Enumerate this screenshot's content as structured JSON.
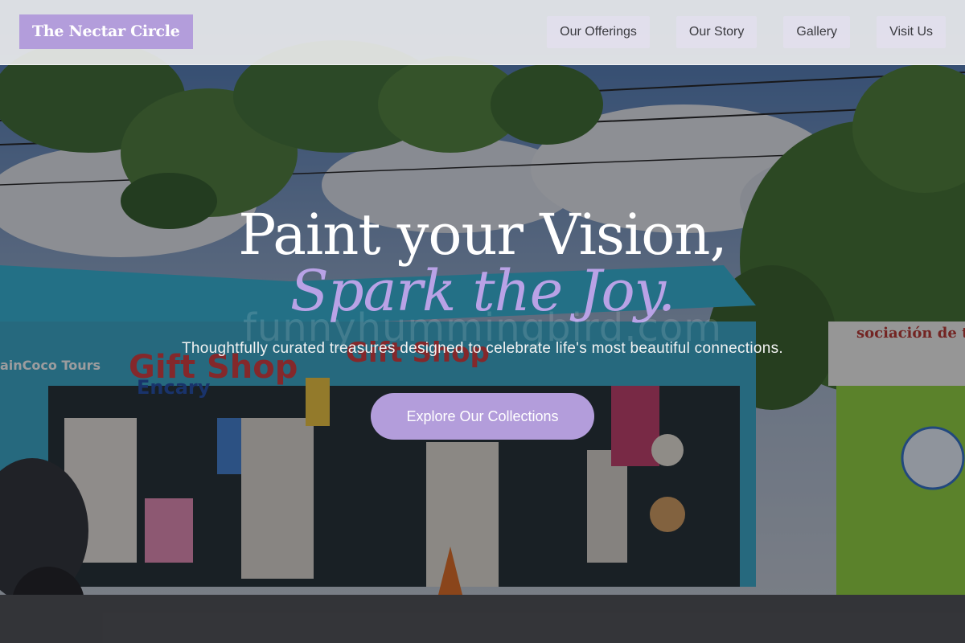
{
  "navbar": {
    "brand": "The Nectar Circle",
    "links": [
      {
        "label": "Our Offerings"
      },
      {
        "label": "Our Story"
      },
      {
        "label": "Gallery"
      },
      {
        "label": "Visit Us"
      }
    ]
  },
  "hero": {
    "headline_line1": "Paint your Vision,",
    "headline_line2": "Spark the Joy.",
    "watermark": "funnyhummingbird.com",
    "subtitle": "Thoughtfully curated treasures designed to celebrate life's most beautiful connections.",
    "cta_label": "Explore Our Collections",
    "background_signs": {
      "gift_shop_left": "Gift Shop",
      "encary": "Encary",
      "gift_shop_center": "Gift Shop",
      "coco_tours": "ainCoco Tours",
      "association": "sociación de tr"
    }
  },
  "colors": {
    "accent": "#b39ddb",
    "accent_text": "#b9a2e6",
    "nav_bg": "#eeeef0",
    "nav_pill": "#e1deec"
  }
}
